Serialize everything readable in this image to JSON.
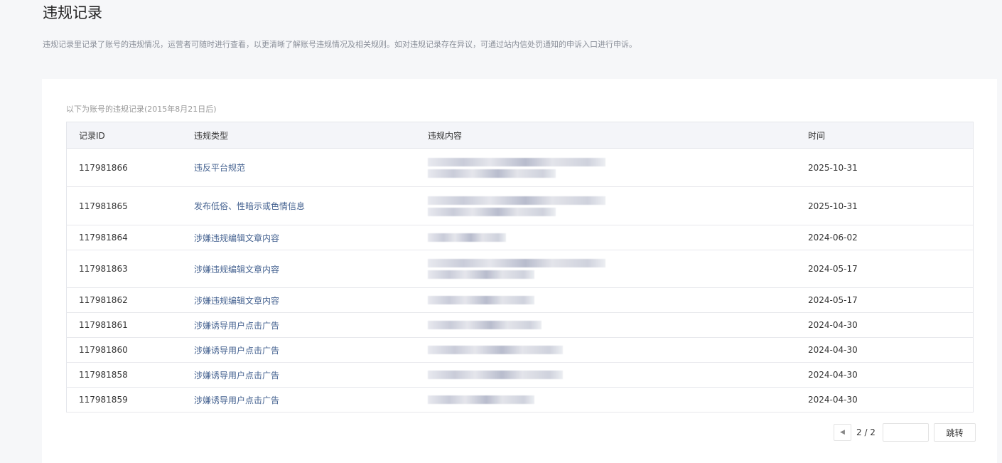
{
  "header": {
    "title": "违规记录",
    "description": "违规记录里记录了账号的违规情况，运营者可随时进行查看，以更清晰了解账号违规情况及相关规则。如对违规记录存在异议，可通过站内信处罚通知的申诉入口进行申诉。"
  },
  "table": {
    "caption": "以下为账号的违规记录(2015年8月21日后)",
    "columns": [
      "记录ID",
      "违规类型",
      "违规内容",
      "时间"
    ],
    "rows": [
      {
        "id": "117981866",
        "type": "违反平台规范",
        "time": "2025-10-31"
      },
      {
        "id": "117981865",
        "type": "发布低俗、性暗示或色情信息",
        "time": "2025-10-31"
      },
      {
        "id": "117981864",
        "type": "涉嫌违规编辑文章内容",
        "time": "2024-06-02"
      },
      {
        "id": "117981863",
        "type": "涉嫌违规编辑文章内容",
        "time": "2024-05-17"
      },
      {
        "id": "117981862",
        "type": "涉嫌违规编辑文章内容",
        "time": "2024-05-17"
      },
      {
        "id": "117981861",
        "type": "涉嫌诱导用户点击广告",
        "time": "2024-04-30"
      },
      {
        "id": "117981860",
        "type": "涉嫌诱导用户点击广告",
        "time": "2024-04-30"
      },
      {
        "id": "117981858",
        "type": "涉嫌诱导用户点击广告",
        "time": "2024-04-30"
      },
      {
        "id": "117981859",
        "type": "涉嫌诱导用户点击广告",
        "time": "2024-04-30"
      }
    ]
  },
  "pagination": {
    "current_of_total": "2 / 2",
    "jump_input_value": "",
    "jump_label": "跳转",
    "prev_icon": "◀"
  }
}
